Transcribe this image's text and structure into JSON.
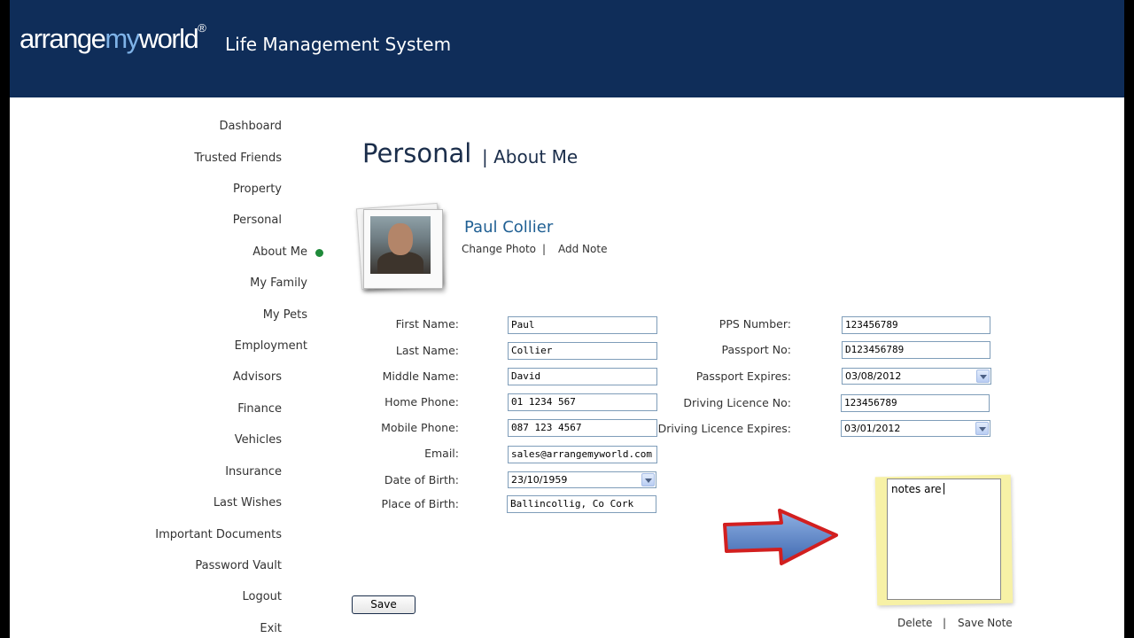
{
  "app": {
    "brand_part1": "arrange",
    "brand_part2": "my",
    "brand_part3": "world",
    "brand_mark": "®",
    "tagline": "Life Management System"
  },
  "sidebar": {
    "items": [
      {
        "label": "Dashboard"
      },
      {
        "label": "Trusted Friends"
      },
      {
        "label": "Property"
      },
      {
        "label": "Personal"
      },
      {
        "label": "About Me",
        "active": true
      },
      {
        "label": "My Family"
      },
      {
        "label": "My Pets"
      },
      {
        "label": "Employment"
      },
      {
        "label": "Advisors"
      },
      {
        "label": "Finance"
      },
      {
        "label": "Vehicles"
      },
      {
        "label": "Insurance"
      },
      {
        "label": "Last Wishes"
      },
      {
        "label": "Important Documents"
      },
      {
        "label": "Password Vault"
      },
      {
        "label": "Logout"
      },
      {
        "label": "Exit"
      }
    ]
  },
  "page": {
    "title": "Personal",
    "subtitle": "| About Me"
  },
  "profile": {
    "name": "Paul Collier",
    "change_photo": "Change Photo",
    "separator": "|",
    "add_note": "Add Note"
  },
  "form_left": {
    "first_name_label": "First Name:",
    "first_name_value": "Paul",
    "last_name_label": "Last Name:",
    "last_name_value": "Collier",
    "middle_name_label": "Middle Name:",
    "middle_name_value": "David",
    "home_phone_label": "Home Phone:",
    "home_phone_value": "01 1234 567",
    "mobile_phone_label": "Mobile Phone:",
    "mobile_phone_value": "087 123 4567",
    "email_label": "Email:",
    "email_value": "sales@arrangemyworld.com",
    "dob_label": "Date of Birth:",
    "dob_value": "23/10/1959",
    "pob_label": "Place of Birth:",
    "pob_value": "Ballincollig, Co Cork"
  },
  "form_right": {
    "pps_label": "PPS Number:",
    "pps_value": "123456789",
    "passport_label": "Passport No:",
    "passport_value": "D123456789",
    "passport_exp_label": "Passport Expires:",
    "passport_exp_value": "03/08/2012",
    "licence_label": "Driving Licence No:",
    "licence_value": "123456789",
    "licence_exp_label": "Driving Licence Expires:",
    "licence_exp_value": "03/01/2012"
  },
  "actions": {
    "save_label": "Save"
  },
  "note": {
    "text": "notes are",
    "delete_label": "Delete",
    "separator": "|",
    "save_note_label": "Save Note"
  },
  "colors": {
    "header_bg": "#0f2d59",
    "brand_accent": "#7fb3e8",
    "active_dot": "#1f8a3a",
    "name_blue": "#1f5f93",
    "arrow_red": "#d21f1f",
    "arrow_blue": "#5b86c8",
    "note_yellow": "#f7f1a6"
  },
  "icons": {
    "annotation_arrow": "arrow-right-icon",
    "dropdown": "chevron-down-icon"
  }
}
